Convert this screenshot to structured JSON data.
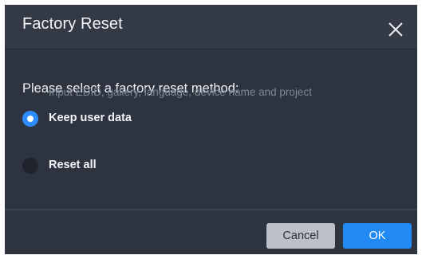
{
  "dialog": {
    "title": "Factory Reset",
    "close_icon": "close-icon"
  },
  "body": {
    "prompt": "Please select a factory reset method:",
    "options": [
      {
        "label": "Keep user data",
        "description": "Input EDID, gallery, language, device name and project",
        "selected": true
      },
      {
        "label": "Reset all",
        "selected": false
      }
    ]
  },
  "footer": {
    "cancel_label": "Cancel",
    "ok_label": "OK"
  },
  "colors": {
    "dialog_bg": "#2d3440",
    "accent": "#2189f4",
    "cancel_bg": "#bcc1c9"
  }
}
